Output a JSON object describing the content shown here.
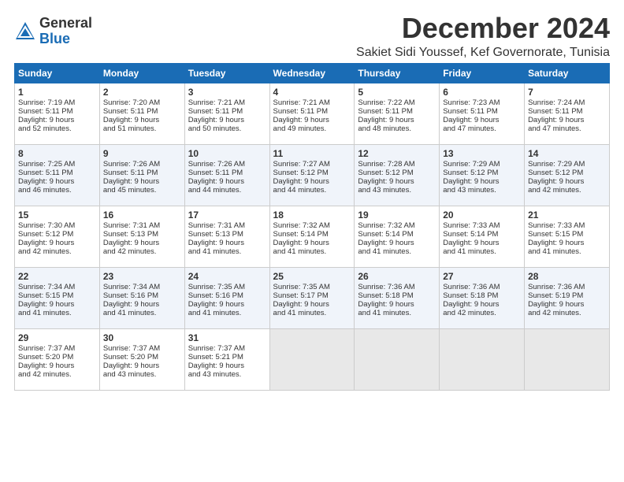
{
  "logo": {
    "general": "General",
    "blue": "Blue"
  },
  "title": "December 2024",
  "location": "Sakiet Sidi Youssef, Kef Governorate, Tunisia",
  "days_of_week": [
    "Sunday",
    "Monday",
    "Tuesday",
    "Wednesday",
    "Thursday",
    "Friday",
    "Saturday"
  ],
  "weeks": [
    [
      {
        "num": "1",
        "lines": [
          "Sunrise: 7:19 AM",
          "Sunset: 5:11 PM",
          "Daylight: 9 hours",
          "and 52 minutes."
        ]
      },
      {
        "num": "2",
        "lines": [
          "Sunrise: 7:20 AM",
          "Sunset: 5:11 PM",
          "Daylight: 9 hours",
          "and 51 minutes."
        ]
      },
      {
        "num": "3",
        "lines": [
          "Sunrise: 7:21 AM",
          "Sunset: 5:11 PM",
          "Daylight: 9 hours",
          "and 50 minutes."
        ]
      },
      {
        "num": "4",
        "lines": [
          "Sunrise: 7:21 AM",
          "Sunset: 5:11 PM",
          "Daylight: 9 hours",
          "and 49 minutes."
        ]
      },
      {
        "num": "5",
        "lines": [
          "Sunrise: 7:22 AM",
          "Sunset: 5:11 PM",
          "Daylight: 9 hours",
          "and 48 minutes."
        ]
      },
      {
        "num": "6",
        "lines": [
          "Sunrise: 7:23 AM",
          "Sunset: 5:11 PM",
          "Daylight: 9 hours",
          "and 47 minutes."
        ]
      },
      {
        "num": "7",
        "lines": [
          "Sunrise: 7:24 AM",
          "Sunset: 5:11 PM",
          "Daylight: 9 hours",
          "and 47 minutes."
        ]
      }
    ],
    [
      {
        "num": "8",
        "lines": [
          "Sunrise: 7:25 AM",
          "Sunset: 5:11 PM",
          "Daylight: 9 hours",
          "and 46 minutes."
        ]
      },
      {
        "num": "9",
        "lines": [
          "Sunrise: 7:26 AM",
          "Sunset: 5:11 PM",
          "Daylight: 9 hours",
          "and 45 minutes."
        ]
      },
      {
        "num": "10",
        "lines": [
          "Sunrise: 7:26 AM",
          "Sunset: 5:11 PM",
          "Daylight: 9 hours",
          "and 44 minutes."
        ]
      },
      {
        "num": "11",
        "lines": [
          "Sunrise: 7:27 AM",
          "Sunset: 5:12 PM",
          "Daylight: 9 hours",
          "and 44 minutes."
        ]
      },
      {
        "num": "12",
        "lines": [
          "Sunrise: 7:28 AM",
          "Sunset: 5:12 PM",
          "Daylight: 9 hours",
          "and 43 minutes."
        ]
      },
      {
        "num": "13",
        "lines": [
          "Sunrise: 7:29 AM",
          "Sunset: 5:12 PM",
          "Daylight: 9 hours",
          "and 43 minutes."
        ]
      },
      {
        "num": "14",
        "lines": [
          "Sunrise: 7:29 AM",
          "Sunset: 5:12 PM",
          "Daylight: 9 hours",
          "and 42 minutes."
        ]
      }
    ],
    [
      {
        "num": "15",
        "lines": [
          "Sunrise: 7:30 AM",
          "Sunset: 5:12 PM",
          "Daylight: 9 hours",
          "and 42 minutes."
        ]
      },
      {
        "num": "16",
        "lines": [
          "Sunrise: 7:31 AM",
          "Sunset: 5:13 PM",
          "Daylight: 9 hours",
          "and 42 minutes."
        ]
      },
      {
        "num": "17",
        "lines": [
          "Sunrise: 7:31 AM",
          "Sunset: 5:13 PM",
          "Daylight: 9 hours",
          "and 41 minutes."
        ]
      },
      {
        "num": "18",
        "lines": [
          "Sunrise: 7:32 AM",
          "Sunset: 5:14 PM",
          "Daylight: 9 hours",
          "and 41 minutes."
        ]
      },
      {
        "num": "19",
        "lines": [
          "Sunrise: 7:32 AM",
          "Sunset: 5:14 PM",
          "Daylight: 9 hours",
          "and 41 minutes."
        ]
      },
      {
        "num": "20",
        "lines": [
          "Sunrise: 7:33 AM",
          "Sunset: 5:14 PM",
          "Daylight: 9 hours",
          "and 41 minutes."
        ]
      },
      {
        "num": "21",
        "lines": [
          "Sunrise: 7:33 AM",
          "Sunset: 5:15 PM",
          "Daylight: 9 hours",
          "and 41 minutes."
        ]
      }
    ],
    [
      {
        "num": "22",
        "lines": [
          "Sunrise: 7:34 AM",
          "Sunset: 5:15 PM",
          "Daylight: 9 hours",
          "and 41 minutes."
        ]
      },
      {
        "num": "23",
        "lines": [
          "Sunrise: 7:34 AM",
          "Sunset: 5:16 PM",
          "Daylight: 9 hours",
          "and 41 minutes."
        ]
      },
      {
        "num": "24",
        "lines": [
          "Sunrise: 7:35 AM",
          "Sunset: 5:16 PM",
          "Daylight: 9 hours",
          "and 41 minutes."
        ]
      },
      {
        "num": "25",
        "lines": [
          "Sunrise: 7:35 AM",
          "Sunset: 5:17 PM",
          "Daylight: 9 hours",
          "and 41 minutes."
        ]
      },
      {
        "num": "26",
        "lines": [
          "Sunrise: 7:36 AM",
          "Sunset: 5:18 PM",
          "Daylight: 9 hours",
          "and 41 minutes."
        ]
      },
      {
        "num": "27",
        "lines": [
          "Sunrise: 7:36 AM",
          "Sunset: 5:18 PM",
          "Daylight: 9 hours",
          "and 42 minutes."
        ]
      },
      {
        "num": "28",
        "lines": [
          "Sunrise: 7:36 AM",
          "Sunset: 5:19 PM",
          "Daylight: 9 hours",
          "and 42 minutes."
        ]
      }
    ],
    [
      {
        "num": "29",
        "lines": [
          "Sunrise: 7:37 AM",
          "Sunset: 5:20 PM",
          "Daylight: 9 hours",
          "and 42 minutes."
        ]
      },
      {
        "num": "30",
        "lines": [
          "Sunrise: 7:37 AM",
          "Sunset: 5:20 PM",
          "Daylight: 9 hours",
          "and 43 minutes."
        ]
      },
      {
        "num": "31",
        "lines": [
          "Sunrise: 7:37 AM",
          "Sunset: 5:21 PM",
          "Daylight: 9 hours",
          "and 43 minutes."
        ]
      },
      {
        "num": "",
        "lines": []
      },
      {
        "num": "",
        "lines": []
      },
      {
        "num": "",
        "lines": []
      },
      {
        "num": "",
        "lines": []
      }
    ]
  ]
}
